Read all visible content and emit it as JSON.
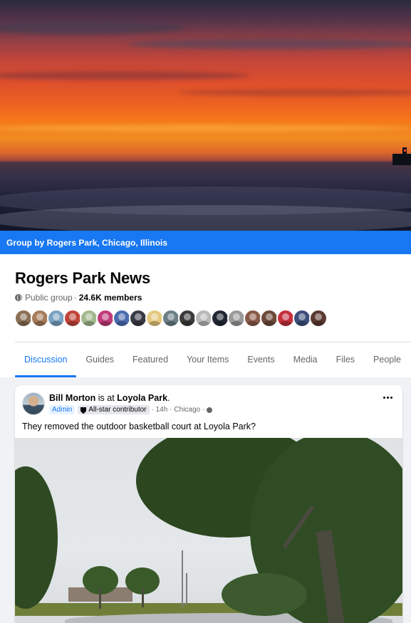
{
  "group_banner": {
    "text": "Group by Rogers Park, Chicago, Illinois"
  },
  "group": {
    "name": "Rogers Park News",
    "privacy": "Public group",
    "separator": "·",
    "members": "24.6K members",
    "member_avatar_colors": [
      "#8a6f55",
      "#a67c5b",
      "#7aa2c1",
      "#c0453a",
      "#a3b98f",
      "#c03a7a",
      "#4c6cb0",
      "#3a3a46",
      "#e6c880",
      "#6d7f86",
      "#3b3b3b",
      "#b9b9b9",
      "#222833",
      "#9a9a9a",
      "#8a5a48",
      "#6b4a3a",
      "#c4303c",
      "#3d4f7a",
      "#5a3a30"
    ]
  },
  "tabs": [
    {
      "label": "Discussion",
      "active": true
    },
    {
      "label": "Guides",
      "active": false
    },
    {
      "label": "Featured",
      "active": false
    },
    {
      "label": "Your Items",
      "active": false
    },
    {
      "label": "Events",
      "active": false
    },
    {
      "label": "Media",
      "active": false
    },
    {
      "label": "Files",
      "active": false
    },
    {
      "label": "People",
      "active": false
    }
  ],
  "post": {
    "author": "Bill Morton",
    "is_at": "is at",
    "place": "Loyola Park",
    "period": ".",
    "admin_badge": "Admin",
    "contributor_badge": "All-star contributor",
    "time": "· 14h ·",
    "location": "Chicago ·",
    "text": "They removed the outdoor basketball court at Loyola Park?"
  },
  "colors": {
    "accent": "#1877f2",
    "muted": "#65676b",
    "background": "#f0f2f5"
  }
}
